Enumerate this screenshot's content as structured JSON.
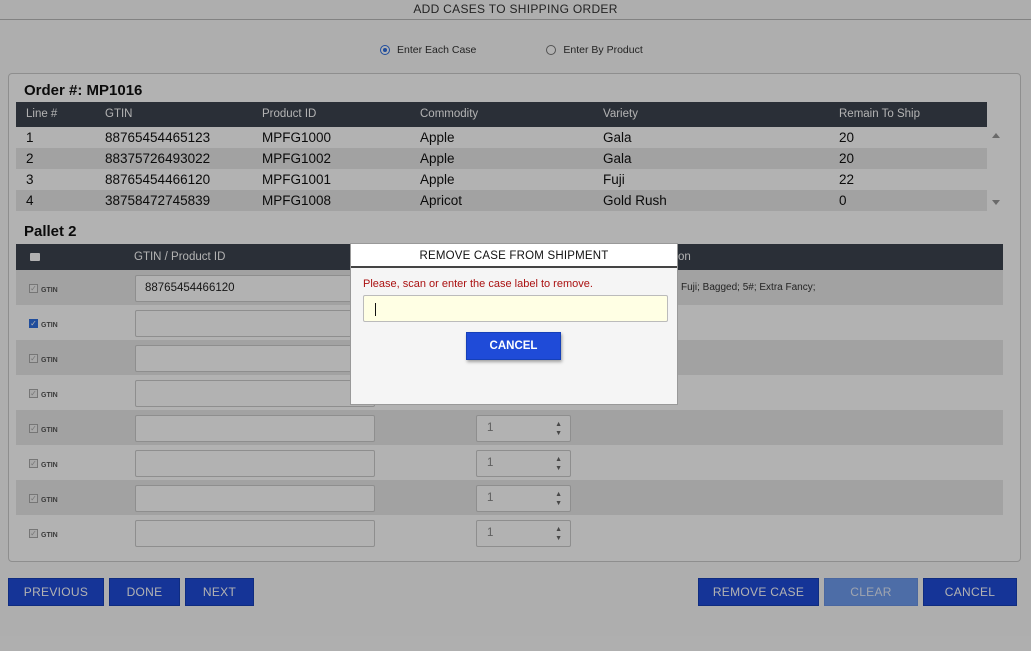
{
  "window": {
    "title": "ADD CASES TO SHIPPING ORDER"
  },
  "modes": [
    {
      "label": "Enter Each Case",
      "selected": true
    },
    {
      "label": "Enter By Product",
      "selected": false
    }
  ],
  "order": {
    "title": "Order #: MP1016",
    "columns": [
      "Line #",
      "GTIN",
      "Product ID",
      "Commodity",
      "Variety",
      "Remain To Ship"
    ],
    "rows": [
      [
        "1",
        "88765454465123",
        "MPFG1000",
        "Apple",
        "Gala",
        "20"
      ],
      [
        "2",
        "88375726493022",
        "MPFG1002",
        "Apple",
        "Gala",
        "20"
      ],
      [
        "3",
        "88765454466120",
        "MPFG1001",
        "Apple",
        "Fuji",
        "22"
      ],
      [
        "4",
        "38758472745839",
        "MPFG1008",
        "Apricot",
        "Gold Rush",
        "0"
      ]
    ]
  },
  "pallet": {
    "title": "Pallet 2",
    "columns": {
      "checkbox_icon": "checklist-icon",
      "gtin": "GTIN / Product ID",
      "description_tail": "on"
    },
    "rows": [
      {
        "checked": false,
        "type": "GTIN",
        "gtin": "88765454466120",
        "qty": "",
        "description": "Fuji; Bagged; 5#; Extra Fancy;"
      },
      {
        "checked": true,
        "type": "GTIN",
        "gtin": "",
        "qty": "",
        "description": ""
      },
      {
        "checked": false,
        "type": "GTIN",
        "gtin": "",
        "qty": "",
        "description": ""
      },
      {
        "checked": false,
        "type": "GTIN",
        "gtin": "",
        "qty": "",
        "description": ""
      },
      {
        "checked": false,
        "type": "GTIN",
        "gtin": "",
        "qty": "1",
        "description": ""
      },
      {
        "checked": false,
        "type": "GTIN",
        "gtin": "",
        "qty": "1",
        "description": ""
      },
      {
        "checked": false,
        "type": "GTIN",
        "gtin": "",
        "qty": "1",
        "description": ""
      },
      {
        "checked": false,
        "type": "GTIN",
        "gtin": "",
        "qty": "1",
        "description": ""
      }
    ]
  },
  "buttons": {
    "previous": "PREVIOUS",
    "done": "DONE",
    "next": "NEXT",
    "remove_case": "REMOVE CASE",
    "clear": "CLEAR",
    "cancel": "CANCEL"
  },
  "modal": {
    "title": "REMOVE CASE FROM SHIPMENT",
    "message": "Please, scan or enter the case label to remove.",
    "input_value": "",
    "cancel_label": "CANCEL"
  },
  "colors": {
    "accent": "#1f4bd8",
    "header": "#3d4450",
    "error_text": "#aa1111"
  }
}
